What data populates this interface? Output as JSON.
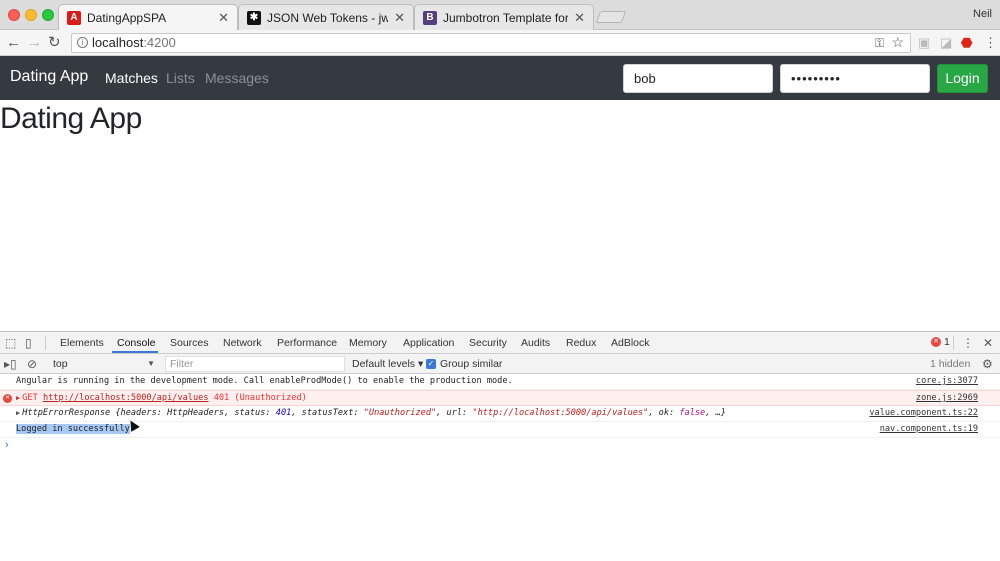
{
  "browser": {
    "tabs": [
      {
        "title": "DatingAppSPA",
        "favicon": "angular-icon",
        "favicon_color": "#dd1b16",
        "favicon_glyph": "A"
      },
      {
        "title": "JSON Web Tokens - jwt.io",
        "favicon": "jwt-icon",
        "favicon_color": "#111111",
        "favicon_glyph": "✱"
      },
      {
        "title": "Jumbotron Template for Boots",
        "favicon": "bootstrap-icon",
        "favicon_color": "#563d7c",
        "favicon_glyph": "B"
      }
    ],
    "profile_name": "Neil",
    "address": {
      "host": "localhost",
      "port": ":4200"
    }
  },
  "app": {
    "brand": "Dating App",
    "nav": [
      {
        "label": "Matches",
        "active": true
      },
      {
        "label": "Lists",
        "active": false
      },
      {
        "label": "Messages",
        "active": false
      }
    ],
    "username_value": "bob",
    "password_value": "•••••••••",
    "login_label": "Login",
    "page_heading": "Dating App"
  },
  "devtools": {
    "tabs": [
      "Elements",
      "Console",
      "Sources",
      "Network",
      "Performance",
      "Memory",
      "Application",
      "Security",
      "Audits",
      "Redux",
      "AdBlock"
    ],
    "active_tab": "Console",
    "error_count": "1",
    "context": "top",
    "filter_placeholder": "Filter",
    "levels_label": "Default levels ▾",
    "group_similar_label": "Group similar",
    "hidden_label": "1 hidden",
    "logs": {
      "angular": {
        "text": "Angular is running in the development mode. Call enableProdMode() to enable the production mode.",
        "source": "core.js:3077"
      },
      "get_error": {
        "method": "GET",
        "url": "http://localhost:5000/api/values",
        "status": "401 (Unauthorized)",
        "source": "zone.js:2969"
      },
      "http_error": {
        "class_name": "HttpErrorResponse",
        "p1": " {headers: HttpHeaders, status: ",
        "status": "401",
        "p2": ", statusText: ",
        "status_text": "\"Unauthorized\"",
        "p3": ", url: ",
        "url": "\"http://localhost:5000/api/values\"",
        "p4": ", ok: ",
        "ok": "false",
        "p5": ", …}",
        "source": "value.component.ts:22"
      },
      "login": {
        "text": "Logged in successfully",
        "source": "nav.component.ts:19"
      }
    },
    "prompt": "›"
  },
  "colors": {
    "navbar": "#343a40",
    "login_button": "#28a745",
    "error": "#e9463d",
    "devtools_accent": "#3879d9"
  }
}
